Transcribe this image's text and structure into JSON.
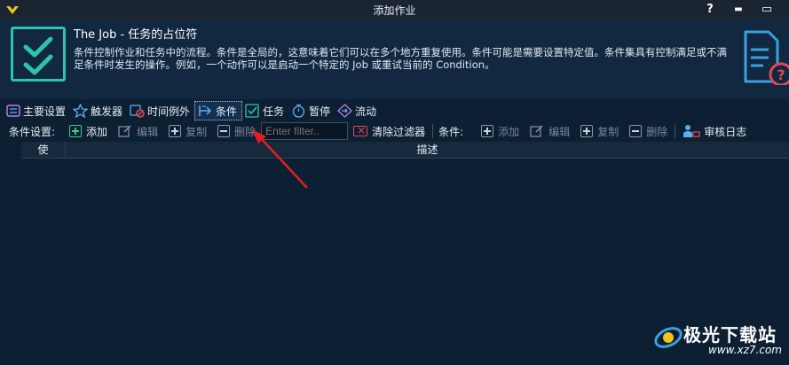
{
  "window": {
    "title": "添加作业",
    "help": "?",
    "minimize": "▬",
    "maximize": "▭"
  },
  "header": {
    "title": "The Job - 任务的占位符",
    "description": "条件控制作业和任务中的流程。条件是全局的，这意味着它们可以在多个地方重复使用。条件可能是需要设置特定值。条件集具有控制满足或不满足条件时发生的操作。例如，一个动作可以是启动一个特定的 Job 或重试当前的 Condition。"
  },
  "tabs": [
    {
      "label": "主要设置",
      "icon": "settings-sliders-icon"
    },
    {
      "label": "触发器",
      "icon": "star-icon"
    },
    {
      "label": "时间例外",
      "icon": "calendar-block-icon"
    },
    {
      "label": "条件",
      "icon": "condition-arrow-icon",
      "active": true
    },
    {
      "label": "任务",
      "icon": "task-check-icon"
    },
    {
      "label": "暂停",
      "icon": "stopwatch-icon"
    },
    {
      "label": "流动",
      "icon": "flow-diamond-icon"
    }
  ],
  "toolbar": {
    "condition_settings_label": "条件设置:",
    "add": "添加",
    "edit": "编辑",
    "copy": "复制",
    "delete": "删除",
    "filter_placeholder": "Enter filter..",
    "clear_filter": "清除过滤器",
    "conditions_label": "条件:",
    "add2": "添加",
    "edit2": "编辑",
    "copy2": "复制",
    "delete2": "删除",
    "audit_log": "审核日志"
  },
  "grid": {
    "col_use": "使",
    "col_desc": "描述"
  },
  "watermark": {
    "cn": "极光下载站",
    "url": "www.xz7.com"
  },
  "colors": {
    "accent": "#2ec4a8",
    "arrow": "#e02020",
    "background": "#0d1f33"
  }
}
